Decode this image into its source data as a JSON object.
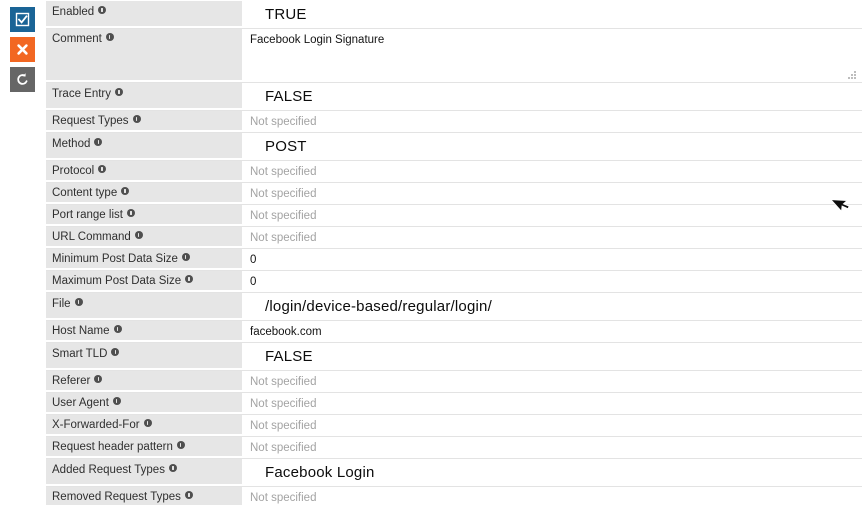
{
  "toolbar": {
    "items": [
      {
        "name": "apply-checkbox-button",
        "icon": "checkbox-checked-icon",
        "color": "#1a6496",
        "title": "Apply"
      },
      {
        "name": "cancel-button",
        "icon": "close-x-icon",
        "color": "#f26722",
        "title": "Cancel"
      },
      {
        "name": "revert-button",
        "icon": "undo-arrow-icon",
        "color": "#666666",
        "title": "Revert"
      }
    ]
  },
  "placeholder_text": "Not specified",
  "properties": [
    {
      "label": "Enabled",
      "value": "TRUE",
      "style": "big",
      "height": "tall"
    },
    {
      "label": "Comment",
      "value": "Facebook Login Signature",
      "style": "plain",
      "height": "comment"
    },
    {
      "label": "Trace Entry",
      "value": "FALSE",
      "style": "big",
      "height": "tall"
    },
    {
      "label": "Request Types",
      "value": "Not specified",
      "style": "placeholder",
      "height": "normal"
    },
    {
      "label": "Method",
      "value": "POST",
      "style": "big",
      "height": "tall"
    },
    {
      "label": "Protocol",
      "value": "Not specified",
      "style": "placeholder",
      "height": "normal"
    },
    {
      "label": "Content type",
      "value": "Not specified",
      "style": "placeholder",
      "height": "normal"
    },
    {
      "label": "Port range list",
      "value": "Not specified",
      "style": "placeholder",
      "height": "normal"
    },
    {
      "label": "URL Command",
      "value": "Not specified",
      "style": "placeholder",
      "height": "normal"
    },
    {
      "label": "Minimum Post Data Size",
      "value": "0",
      "style": "plain",
      "height": "normal"
    },
    {
      "label": "Maximum Post Data Size",
      "value": "0",
      "style": "plain",
      "height": "normal"
    },
    {
      "label": "File",
      "value": "/login/device-based/regular/login/",
      "style": "big",
      "height": "tall"
    },
    {
      "label": "Host Name",
      "value": "facebook.com",
      "style": "plain",
      "height": "normal"
    },
    {
      "label": "Smart TLD",
      "value": "FALSE",
      "style": "big",
      "height": "tall"
    },
    {
      "label": "Referer",
      "value": "Not specified",
      "style": "placeholder",
      "height": "normal"
    },
    {
      "label": "User Agent",
      "value": "Not specified",
      "style": "placeholder",
      "height": "normal"
    },
    {
      "label": "X-Forwarded-For",
      "value": "Not specified",
      "style": "placeholder",
      "height": "normal"
    },
    {
      "label": "Request header pattern",
      "value": "Not specified",
      "style": "placeholder",
      "height": "normal"
    },
    {
      "label": "Added Request Types",
      "value": "Facebook Login",
      "style": "big",
      "height": "tall"
    },
    {
      "label": "Removed Request Types",
      "value": "Not specified",
      "style": "placeholder",
      "height": "normal"
    }
  ],
  "cursor": {
    "name": "mouse-pointer-cursor"
  },
  "colors": {
    "label_bg": "#e6e6e6",
    "row_border": "#e3e3e3",
    "placeholder": "#a3a3a3",
    "accent_blue": "#1a6496",
    "accent_orange": "#f26722",
    "accent_gray": "#666666"
  }
}
